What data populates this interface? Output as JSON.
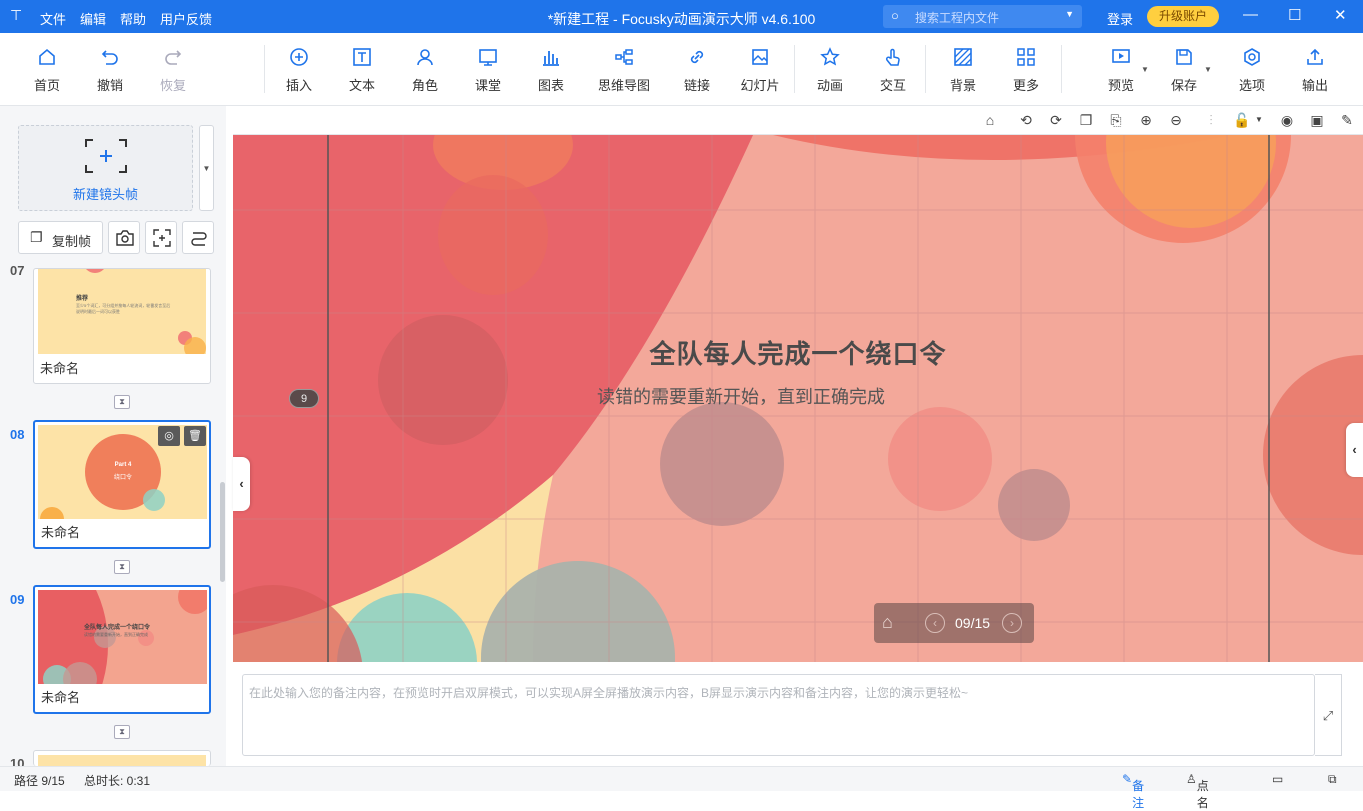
{
  "window": {
    "logo_icon": "pin-icon",
    "menu": [
      "文件",
      "编辑",
      "帮助",
      "用户反馈"
    ],
    "title": "*新建工程 - Focusky动画演示大师  v4.6.100",
    "search_placeholder": "搜索工程内文件",
    "login": "登录",
    "upgrade": "升级账户"
  },
  "toolbar": {
    "home": "首页",
    "undo": "撤销",
    "redo": "恢复",
    "insert": "插入",
    "text": "文本",
    "role": "角色",
    "classroom": "课堂",
    "chart": "图表",
    "mindmap": "思维导图",
    "link": "链接",
    "slides": "幻灯片",
    "animation": "动画",
    "interact": "交互",
    "background": "背景",
    "more": "更多",
    "preview": "预览",
    "save": "保存",
    "options": "选项",
    "export": "输出"
  },
  "left": {
    "new_frame": "新建镜头帧",
    "copy_frame": "复制帧",
    "slides": [
      {
        "num": "07",
        "name": "未命名",
        "thumb_title": "推荐",
        "thumb_body": "至少5个词汇，可分组并按每人轮流词，轮番发言至后\n说明时最后一词可以获胜"
      },
      {
        "num": "08",
        "name": "未命名",
        "thumb_title": "Part 4",
        "thumb_sub": "绕口令"
      },
      {
        "num": "09",
        "name": "未命名",
        "thumb_title": "全队每人完成一个绕口令",
        "thumb_sub": "读错的需要重新开始，直到正确完成"
      },
      {
        "num": "10"
      }
    ]
  },
  "stage": {
    "title": "全队每人完成一个绕口令",
    "subtitle": "读错的需要重新开始，直到正确完成",
    "frame_badge": "9",
    "pager": "09/15"
  },
  "notes_placeholder": "在此处输入您的备注内容，在预览时开启双屏模式，可以实现A屏全屏播放演示内容，B屏显示演示内容和备注内容，让您的演示更轻松~",
  "status": {
    "path": "路径 9/15",
    "duration": "总时长: 0:31",
    "notes": "备注",
    "rollcall": "点名"
  },
  "colors": {
    "accent": "#1f74ea",
    "upgrade": "#ffcf3f"
  }
}
